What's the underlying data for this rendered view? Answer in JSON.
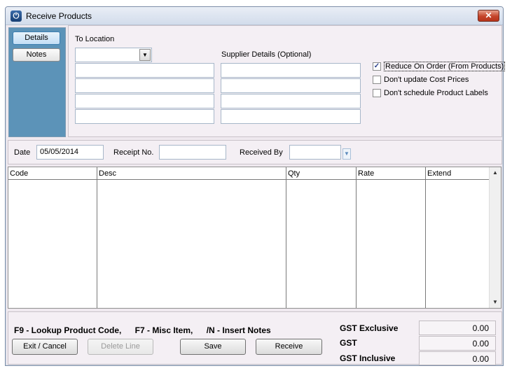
{
  "window": {
    "title": "Receive Products",
    "close_glyph": "✕",
    "icon": "power-icon"
  },
  "sidebar": {
    "tabs": [
      {
        "label": "Details",
        "active": true
      },
      {
        "label": "Notes",
        "active": false
      }
    ]
  },
  "location": {
    "label": "To Location",
    "value": "",
    "lines": [
      "",
      "",
      "",
      ""
    ]
  },
  "supplier": {
    "label": "Supplier Details (Optional)",
    "lines": [
      "",
      "",
      "",
      ""
    ]
  },
  "options": [
    {
      "label": "Reduce On Order (From Products)",
      "checked": true
    },
    {
      "label": "Don't update Cost Prices",
      "checked": false
    },
    {
      "label": "Don't schedule Product Labels",
      "checked": false
    }
  ],
  "receipt": {
    "date_label": "Date",
    "date_value": "05/05/2014",
    "receipt_label": "Receipt No.",
    "receipt_value": "",
    "received_by_label": "Received By",
    "received_by_value": ""
  },
  "grid": {
    "columns": [
      "Code",
      "Desc",
      "Qty",
      "Rate",
      "Extend"
    ],
    "rows": []
  },
  "hints": [
    "F9 - Lookup Product Code,",
    "F7 - Misc Item,",
    "/N - Insert Notes"
  ],
  "totals": {
    "gst_exclusive_label": "GST Exclusive",
    "gst_exclusive": "0.00",
    "gst_label": "GST",
    "gst": "0.00",
    "gst_inclusive_label": "GST Inclusive",
    "gst_inclusive": "0.00"
  },
  "buttons": {
    "exit": "Exit / Cancel",
    "delete_line": "Delete Line",
    "save": "Save",
    "receive": "Receive"
  },
  "colors": {
    "sidebar": "#5c93b8",
    "window_bg": "#efe9ef",
    "close": "#c4442a"
  }
}
